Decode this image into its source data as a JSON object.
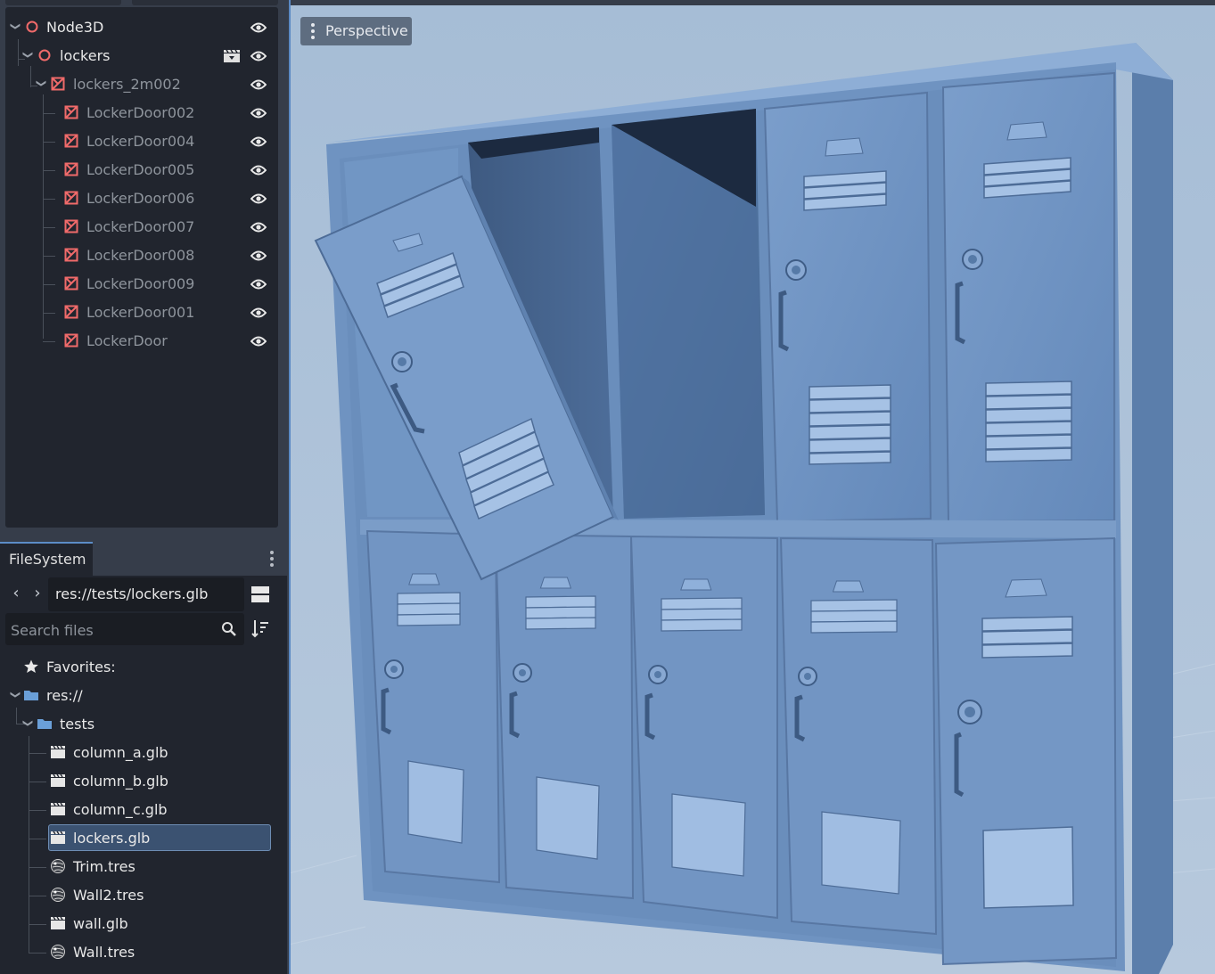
{
  "scene_tree": {
    "nodes": [
      {
        "name": "Node3D",
        "type": "node3d"
      },
      {
        "name": "lockers",
        "type": "node3d"
      },
      {
        "name": "lockers_2m002",
        "type": "mesh"
      },
      {
        "name": "LockerDoor002",
        "type": "mesh"
      },
      {
        "name": "LockerDoor004",
        "type": "mesh"
      },
      {
        "name": "LockerDoor005",
        "type": "mesh"
      },
      {
        "name": "LockerDoor006",
        "type": "mesh"
      },
      {
        "name": "LockerDoor007",
        "type": "mesh"
      },
      {
        "name": "LockerDoor008",
        "type": "mesh"
      },
      {
        "name": "LockerDoor009",
        "type": "mesh"
      },
      {
        "name": "LockerDoor001",
        "type": "mesh"
      },
      {
        "name": "LockerDoor",
        "type": "mesh"
      }
    ]
  },
  "filesystem": {
    "tab_label": "FileSystem",
    "current_path": "res://tests/lockers.glb",
    "search_placeholder": "Search files",
    "favorites_label": "Favorites:",
    "root_label": "res://",
    "folder_label": "tests",
    "files": [
      {
        "name": "column_a.glb",
        "icon": "scene-file-icon"
      },
      {
        "name": "column_b.glb",
        "icon": "scene-file-icon"
      },
      {
        "name": "column_c.glb",
        "icon": "scene-file-icon"
      },
      {
        "name": "lockers.glb",
        "icon": "scene-file-icon",
        "selected": true
      },
      {
        "name": "Trim.tres",
        "icon": "material-sphere-icon"
      },
      {
        "name": "Wall2.tres",
        "icon": "material-sphere-icon"
      },
      {
        "name": "wall.glb",
        "icon": "scene-file-icon"
      },
      {
        "name": "Wall.tres",
        "icon": "material-sphere-icon"
      }
    ]
  },
  "viewport": {
    "view_mode": "Perspective"
  },
  "colors": {
    "accent": "#5a89c4",
    "node_icon": "#f06a6a",
    "panel_bg": "#21252e",
    "viewport_bg": "#a9c0d9",
    "locker": "#6e92bf"
  }
}
